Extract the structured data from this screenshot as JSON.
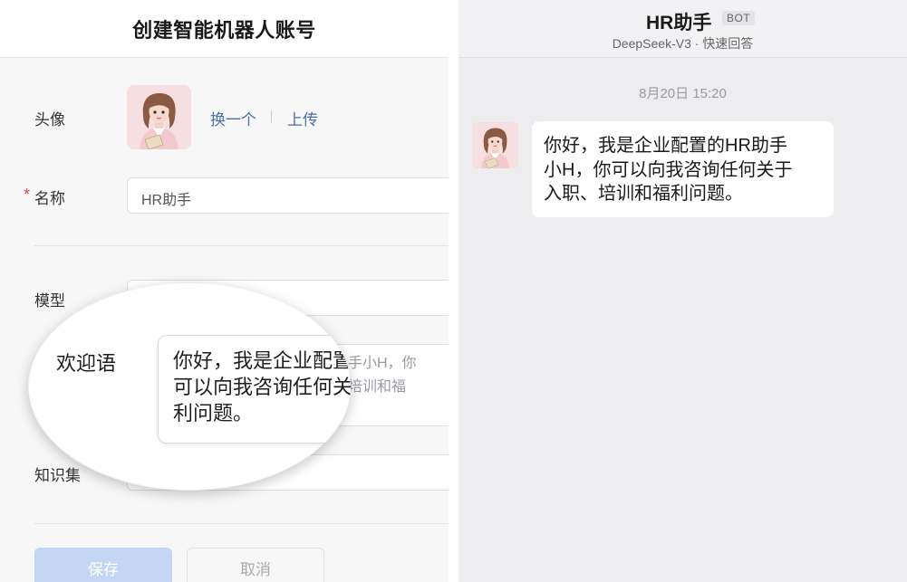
{
  "form": {
    "title": "创建智能机器人账号",
    "avatar": {
      "label": "头像",
      "change_link": "换一个",
      "upload_link": "上传"
    },
    "name": {
      "required_mark": "*",
      "label": "名称",
      "value": "HR助手"
    },
    "model": {
      "label": "模型"
    },
    "greeting": {
      "label": "欢迎语",
      "value": "你好，我是企业配置的HR助手小H，你可以向我咨询任何关于入职、培训和福利问题。",
      "visible_fragment_lines": [
        "手小H，你",
        "培训和福"
      ],
      "magnified_lines": "你好，我是企业配置\n可以向我咨询任何关\n利问题。"
    },
    "knowledge": {
      "label": "知识集"
    },
    "buttons": {
      "save": "保存",
      "cancel": "取消"
    }
  },
  "chat": {
    "bot_name": "HR助手",
    "badge": "BOT",
    "subtitle": "DeepSeek-V3 · 快速回答",
    "timestamp": "8月20日 15:20",
    "message": "你好，我是企业配置的HR助手\n小H，你可以向我咨询任何关于\n入职、培训和福利问题。"
  },
  "colors": {
    "link": "#4a6fa5",
    "save_button": "#c3d7f5",
    "required": "#e5533d",
    "chat_bg": "#ededf0"
  }
}
